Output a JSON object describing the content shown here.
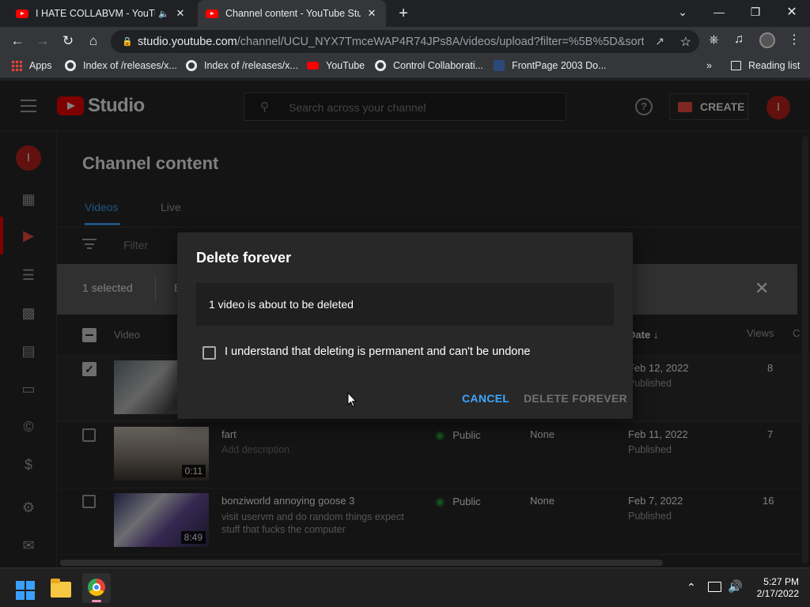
{
  "browser": {
    "tabs": [
      {
        "title": "I HATE COLLABVM - YouTube",
        "active": false
      },
      {
        "title": "Channel content - YouTube Studio",
        "active": true
      }
    ],
    "new_tab": "+",
    "url_host": "studio.youtube.com",
    "url_path": "/channel/UCU_NYX7TmceWAP4R74JPs8A/videos/upload?filter=%5B%5D&sort=%...",
    "bookmarks": [
      {
        "label": "Apps",
        "icon": "apps-grid-icon"
      },
      {
        "label": "Index of /releases/x...",
        "icon": "globe-icon"
      },
      {
        "label": "Index of /releases/x...",
        "icon": "globe-icon"
      },
      {
        "label": "YouTube",
        "icon": "youtube-icon"
      },
      {
        "label": "Control Collaborati...",
        "icon": "globe-icon"
      },
      {
        "label": "FrontPage 2003 Do...",
        "icon": "frontpage-icon"
      }
    ],
    "reading_list": "Reading list",
    "more_bookmarks": "»"
  },
  "studio": {
    "logo_text": "Studio",
    "search_placeholder": "Search across your channel",
    "create_label": "CREATE",
    "avatar_letter": "I",
    "page_title": "Channel content",
    "tabs": [
      "Videos",
      "Live"
    ],
    "filter_label": "Filter",
    "selected_label": "1 selected",
    "selected_extra": "E",
    "columns": {
      "video": "Video",
      "date": "Date",
      "views": "Views",
      "comments": "C"
    },
    "rows": [
      {
        "title": "",
        "description": "",
        "visibility": "",
        "restrictions": "",
        "date": "Feb 12, 2022",
        "status": "Published",
        "views": "8",
        "duration": "",
        "checked": true
      },
      {
        "title": "fart",
        "description": "Add description",
        "visibility": "Public",
        "restrictions": "None",
        "date": "Feb 11, 2022",
        "status": "Published",
        "views": "7",
        "duration": "0:11",
        "checked": false
      },
      {
        "title": "bonziworld annoying goose 3",
        "description": "visit uservm and do random things expect stuff that fucks the computer",
        "visibility": "Public",
        "restrictions": "None",
        "date": "Feb 7, 2022",
        "status": "Published",
        "views": "16",
        "duration": "8:49",
        "checked": false
      }
    ]
  },
  "dialog": {
    "title": "Delete forever",
    "message": "1 video is about to be deleted",
    "confirm_label": "I understand that deleting is permanent and can't be undone",
    "cancel": "CANCEL",
    "delete": "DELETE FOREVER"
  },
  "taskbar": {
    "time": "5:27 PM",
    "date": "2/17/2022"
  },
  "colors": {
    "accent_blue": "#3ea6ff",
    "youtube_red": "#ff0000",
    "public_green": "#2ba640"
  }
}
